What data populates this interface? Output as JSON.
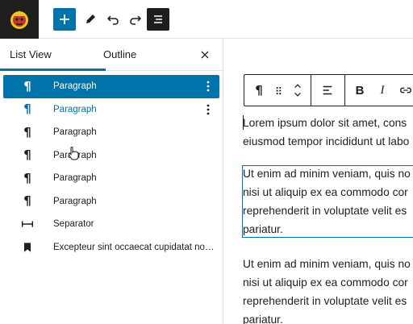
{
  "toolbar": {
    "logo_icon": "site-logo-icon",
    "add_icon": "plus-icon",
    "edit_icon": "pencil-icon",
    "undo_icon": "undo-icon",
    "redo_icon": "redo-icon",
    "listview_icon": "list-view-icon"
  },
  "sidebar": {
    "tabs": [
      {
        "label": "List View"
      },
      {
        "label": "Outline"
      }
    ],
    "close_icon": "close-icon",
    "items": [
      {
        "label": "Paragraph",
        "icon": "paragraph-icon",
        "state": "selected"
      },
      {
        "label": "Paragraph",
        "icon": "paragraph-icon",
        "state": "hovered"
      },
      {
        "label": "Paragraph",
        "icon": "paragraph-icon"
      },
      {
        "label": "Paragraph",
        "icon": "paragraph-icon"
      },
      {
        "label": "Paragraph",
        "icon": "paragraph-icon"
      },
      {
        "label": "Paragraph",
        "icon": "paragraph-icon"
      },
      {
        "label": "Separator",
        "icon": "separator-icon"
      },
      {
        "label": "Excepteur sint occaecat cupidatat non ...",
        "icon": "bookmark-icon"
      }
    ]
  },
  "block_toolbar": {
    "icons": [
      "paragraph-icon",
      "drag-handle-icon",
      "move-up-down-icon",
      "align-icon",
      "bold-icon",
      "italic-icon",
      "link-icon"
    ],
    "bold_label": "B",
    "italic_label": "I"
  },
  "editor": {
    "paragraphs": [
      {
        "lines": [
          "Lorem ipsum dolor sit amet, cons",
          "eiusmod tempor incididunt ut labo"
        ]
      },
      {
        "lines": [
          "Ut enim ad minim veniam, quis no",
          "nisi ut aliquip ex ea commodo cor",
          "reprehenderit in voluptate velit es",
          "pariatur."
        ]
      },
      {
        "lines": [
          "Ut enim ad minim veniam, quis no",
          "nisi ut aliquip ex ea commodo cor",
          "reprehenderit in voluptate velit es",
          "pariatur."
        ]
      }
    ]
  },
  "colors": {
    "accent": "#0073aa",
    "dark": "#1e1e1e",
    "border": "#e0e0e0"
  }
}
